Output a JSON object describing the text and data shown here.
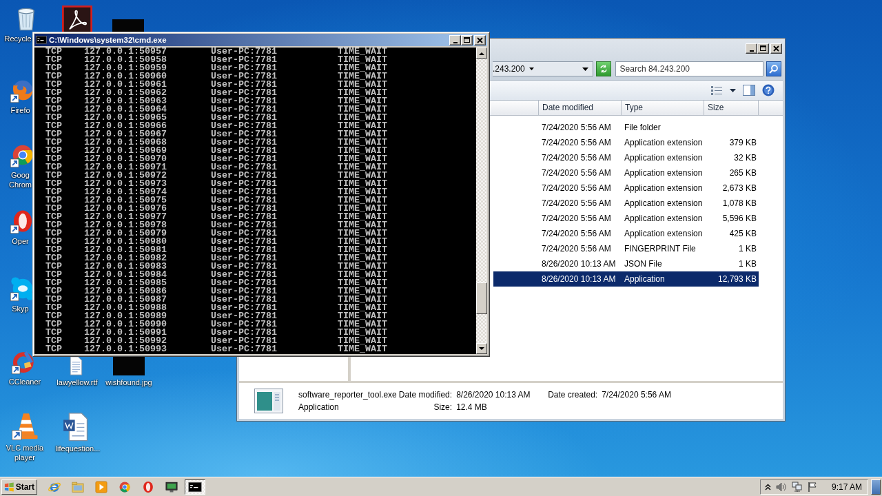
{
  "desktop_icons": [
    {
      "kind": "recycle",
      "label": "Recycle",
      "shortcut": false
    },
    {
      "kind": "pdf",
      "shortcut": false
    },
    {
      "kind": "thumbnail",
      "shortcut": false
    },
    {
      "kind": "firefox",
      "label": "Firefo",
      "shortcut": true
    },
    {
      "kind": "chrome",
      "label": "Goog Chrom",
      "shortcut": true
    },
    {
      "kind": "opera",
      "label": "Oper",
      "shortcut": true
    },
    {
      "kind": "skype",
      "label": "Skyp",
      "shortcut": true
    },
    {
      "kind": "ccleaner",
      "label": "CCleaner",
      "shortcut": true
    },
    {
      "kind": "document",
      "label": "lawyellow.rtf",
      "shortcut": false
    },
    {
      "kind": "thumbnail",
      "label": "wishfound.jpg",
      "shortcut": false
    },
    {
      "kind": "vlc",
      "label": "VLC media player",
      "shortcut": true
    },
    {
      "kind": "word",
      "label": "lifequestion...",
      "shortcut": false
    }
  ],
  "cmd_window": {
    "title": "C:\\Windows\\system32\\cmd.exe",
    "lines": [
      "TCP    127.0.0.1:50957        User-PC:7781           TIME_WAIT",
      "TCP    127.0.0.1:50958        User-PC:7781           TIME_WAIT",
      "TCP    127.0.0.1:50959        User-PC:7781           TIME_WAIT",
      "TCP    127.0.0.1:50960        User-PC:7781           TIME_WAIT",
      "TCP    127.0.0.1:50961        User-PC:7781           TIME_WAIT",
      "TCP    127.0.0.1:50962        User-PC:7781           TIME_WAIT",
      "TCP    127.0.0.1:50963        User-PC:7781           TIME_WAIT",
      "TCP    127.0.0.1:50964        User-PC:7781           TIME_WAIT",
      "TCP    127.0.0.1:50965        User-PC:7781           TIME_WAIT",
      "TCP    127.0.0.1:50966        User-PC:7781           TIME_WAIT",
      "TCP    127.0.0.1:50967        User-PC:7781           TIME_WAIT",
      "TCP    127.0.0.1:50968        User-PC:7781           TIME_WAIT",
      "TCP    127.0.0.1:50969        User-PC:7781           TIME_WAIT",
      "TCP    127.0.0.1:50970        User-PC:7781           TIME_WAIT",
      "TCP    127.0.0.1:50971        User-PC:7781           TIME_WAIT",
      "TCP    127.0.0.1:50972        User-PC:7781           TIME_WAIT",
      "TCP    127.0.0.1:50973        User-PC:7781           TIME_WAIT",
      "TCP    127.0.0.1:50974        User-PC:7781           TIME_WAIT",
      "TCP    127.0.0.1:50975        User-PC:7781           TIME_WAIT",
      "TCP    127.0.0.1:50976        User-PC:7781           TIME_WAIT",
      "TCP    127.0.0.1:50977        User-PC:7781           TIME_WAIT",
      "TCP    127.0.0.1:50978        User-PC:7781           TIME_WAIT",
      "TCP    127.0.0.1:50979        User-PC:7781           TIME_WAIT",
      "TCP    127.0.0.1:50980        User-PC:7781           TIME_WAIT",
      "TCP    127.0.0.1:50981        User-PC:7781           TIME_WAIT",
      "TCP    127.0.0.1:50982        User-PC:7781           TIME_WAIT",
      "TCP    127.0.0.1:50983        User-PC:7781           TIME_WAIT",
      "TCP    127.0.0.1:50984        User-PC:7781           TIME_WAIT",
      "TCP    127.0.0.1:50985        User-PC:7781           TIME_WAIT",
      "TCP    127.0.0.1:50986        User-PC:7781           TIME_WAIT",
      "TCP    127.0.0.1:50987        User-PC:7781           TIME_WAIT",
      "TCP    127.0.0.1:50988        User-PC:7781           TIME_WAIT",
      "TCP    127.0.0.1:50989        User-PC:7781           TIME_WAIT",
      "TCP    127.0.0.1:50990        User-PC:7781           TIME_WAIT",
      "TCP    127.0.0.1:50991        User-PC:7781           TIME_WAIT",
      "TCP    127.0.0.1:50992        User-PC:7781           TIME_WAIT",
      "TCP    127.0.0.1:50993        User-PC:7781           TIME_WAIT"
    ]
  },
  "explorer_window": {
    "address": ".243.200",
    "search": {
      "placeholder": "Search 84.243.200"
    },
    "columns": [
      "Date modified",
      "Type",
      "Size"
    ],
    "rows": [
      {
        "date": "7/24/2020 5:56 AM",
        "type": "File folder",
        "selected": false
      },
      {
        "date": "7/24/2020 5:56 AM",
        "type": "Application extension",
        "size": "379 KB",
        "selected": false
      },
      {
        "date": "7/24/2020 5:56 AM",
        "type": "Application extension",
        "size": "32 KB",
        "selected": false
      },
      {
        "date": "7/24/2020 5:56 AM",
        "type": "Application extension",
        "size": "265 KB",
        "selected": false
      },
      {
        "date": "7/24/2020 5:56 AM",
        "type": "Application extension",
        "size": "2,673 KB",
        "selected": false
      },
      {
        "date": "7/24/2020 5:56 AM",
        "type": "Application extension",
        "size": "1,078 KB",
        "selected": false
      },
      {
        "date": "7/24/2020 5:56 AM",
        "type": "Application extension",
        "size": "5,596 KB",
        "selected": false
      },
      {
        "date": "7/24/2020 5:56 AM",
        "type": "Application extension",
        "size": "425 KB",
        "selected": false
      },
      {
        "date": "7/24/2020 5:56 AM",
        "type": "FINGERPRINT File",
        "size": "1 KB",
        "selected": false
      },
      {
        "date": "8/26/2020 10:13 AM",
        "type": "JSON File",
        "size": "1 KB",
        "selected": false
      },
      {
        "date": "8/26/2020 10:13 AM",
        "type": "Application",
        "size": "12,793 KB",
        "selected": true
      }
    ],
    "details": {
      "name": "software_reporter_tool.exe",
      "type": "Application",
      "modified_label": "Date modified:",
      "modified": "8/26/2020 10:13 AM",
      "created_label": "Date created:",
      "created": "7/24/2020 5:56 AM",
      "size_label": "Size:",
      "size": "12.4 MB"
    }
  },
  "taskbar": {
    "start": "Start",
    "apps": [
      {
        "kind": "ie",
        "active": false
      },
      {
        "kind": "folder",
        "active": false
      },
      {
        "kind": "media",
        "active": false
      },
      {
        "kind": "chrome",
        "active": false
      },
      {
        "kind": "opera",
        "active": false
      },
      {
        "kind": "monitor",
        "active": false
      },
      {
        "kind": "cmd",
        "active": true
      }
    ],
    "clock": "9:17 AM"
  }
}
